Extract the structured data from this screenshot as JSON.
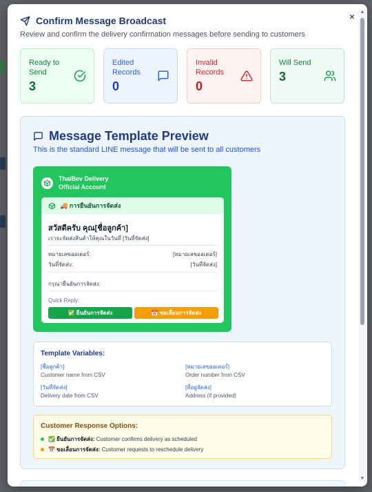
{
  "header": {
    "title": "Confirm Message Broadcast",
    "subtitle": "Review and confirm the delivery confirmation messages before sending to customers",
    "close_symbol": "×"
  },
  "stats": [
    {
      "label": "Ready to Send",
      "value": "3",
      "icon": "check-circle-icon"
    },
    {
      "label": "Edited Records",
      "value": "0",
      "icon": "message-square-icon"
    },
    {
      "label": "Invalid Records",
      "value": "0",
      "icon": "warning-triangle-icon"
    },
    {
      "label": "Will Send",
      "value": "3",
      "icon": "users-icon"
    }
  ],
  "template": {
    "title": "Message Template Preview",
    "subtitle": "This is the standard LINE message that will be sent to all customers",
    "account_name": "ThaiBev Delivery",
    "account_type": "Official Account",
    "bubble_header": "🚚 การยืนยันการจัดส่ง",
    "greeting": "สวัสดีครับ คุณ[ชื่อลูกค้า]",
    "greeting_line2": "เราจะจัดส่งสินค้าให้คุณในวันที่ [วันที่จัดส่ง]",
    "order_label": "หมายเลขออเดอร์:",
    "order_value": "[หมายเลขออเดอร์]",
    "date_label": "วันที่จัดส่ง:",
    "date_value": "[วันที่จัดส่ง]",
    "confirm_prompt": "กรุณายืนยันการจัดส่ง:",
    "quick_reply_label": "Quick Reply:",
    "qr_confirm": "✅ ยืนยันการจัดส่ง",
    "qr_reschedule": "📅 ขอเลื่อนการจัดส่ง"
  },
  "variables": {
    "title": "Template Variables:",
    "items": [
      {
        "key": "[ชื่อลูกค้า]",
        "desc": "Customer name from CSV"
      },
      {
        "key": "[หมายเลขออเดอร์]",
        "desc": "Order number from CSV"
      },
      {
        "key": "[วันที่จัดส่ง]",
        "desc": "Delivery date from CSV"
      },
      {
        "key": "[ที่อยู่จัดส่ง]",
        "desc": "Address (if provided)"
      }
    ]
  },
  "responses": {
    "title": "Customer Response Options:",
    "items": [
      {
        "name": "✅ ยืนยันการจัดส่ง:",
        "desc": "Customer confirms delivery as scheduled",
        "color": "#22c55e"
      },
      {
        "name": "📅 ขอเลื่อนการจัดส่ง:",
        "desc": "Customer requests to reschedule delivery",
        "color": "#f59e0b"
      }
    ]
  },
  "colors": {
    "line_green": "#22c55e",
    "primary_blue": "#1e3a8a",
    "warning_orange": "#f59e0b"
  }
}
